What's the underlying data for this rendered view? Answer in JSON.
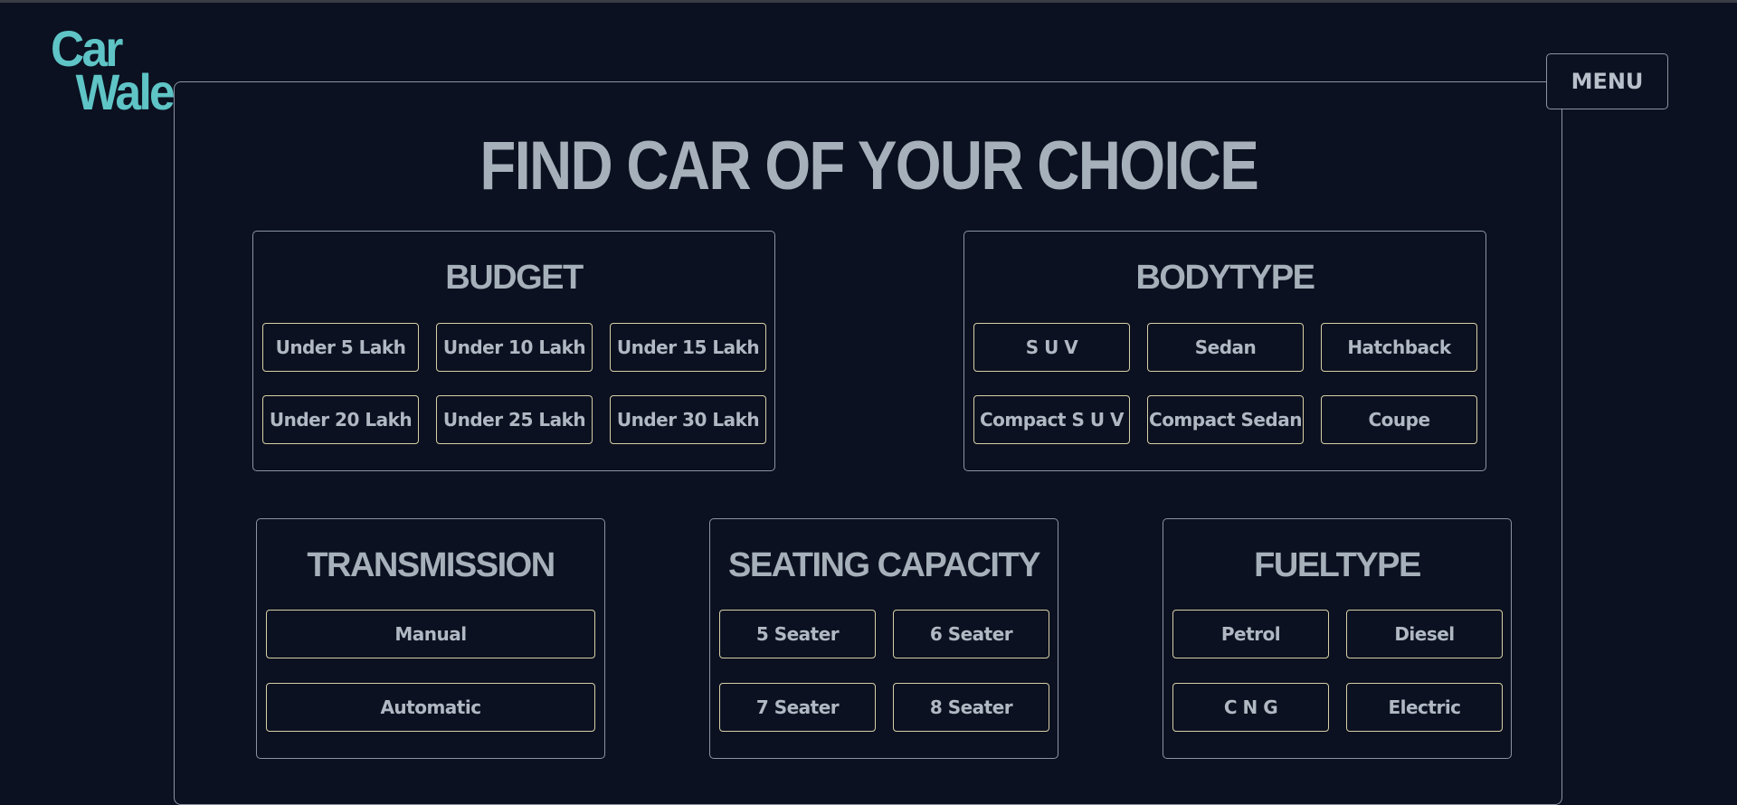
{
  "logo": {
    "line1": "Car",
    "line2": "Wale"
  },
  "menu": {
    "label": "MENU"
  },
  "page_title": "FIND CAR OF YOUR CHOICE",
  "budget": {
    "title": "BUDGET",
    "options": [
      "Under 5 Lakh",
      "Under 10 Lakh",
      "Under 15 Lakh",
      "Under 20 Lakh",
      "Under 25 Lakh",
      "Under 30 Lakh"
    ]
  },
  "bodytype": {
    "title": "BODYTYPE",
    "options": [
      "S U V",
      "Sedan",
      "Hatchback",
      "Compact S U V",
      "Compact Sedan",
      "Coupe"
    ]
  },
  "transmission": {
    "title": "TRANSMISSION",
    "options": [
      "Manual",
      "Automatic"
    ]
  },
  "seating": {
    "title": "SEATING CAPACITY",
    "options": [
      "5 Seater",
      "6 Seater",
      "7 Seater",
      "8 Seater"
    ]
  },
  "fueltype": {
    "title": "FUELTYPE",
    "options": [
      "Petrol",
      "Diesel",
      "C N G",
      "Electric"
    ]
  }
}
